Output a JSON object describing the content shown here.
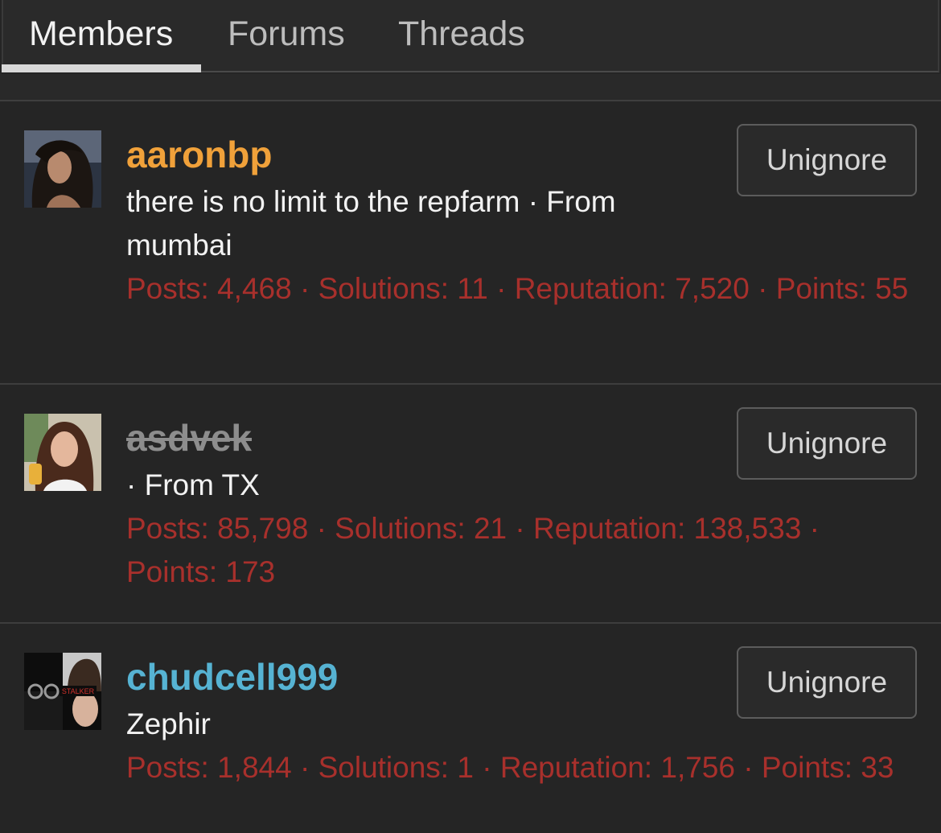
{
  "tabs": [
    {
      "label": "Members",
      "active": true
    },
    {
      "label": "Forums",
      "active": false
    },
    {
      "label": "Threads",
      "active": false
    }
  ],
  "members": [
    {
      "username": "aaronbp",
      "description": "there is no limit to the repfarm · From mumbai",
      "stats": {
        "posts_label": "Posts:",
        "posts": "4,468",
        "solutions_label": "Solutions:",
        "solutions": "11",
        "reputation_label": "Reputation:",
        "reputation": "7,520",
        "points_label": "Points:",
        "points": "55"
      },
      "button": "Unignore"
    },
    {
      "username": "asdvek",
      "description": "· From TX",
      "stats": {
        "posts_label": "Posts:",
        "posts": "85,798",
        "solutions_label": "Solutions:",
        "solutions": "21",
        "reputation_label": "Reputation:",
        "reputation": "138,533",
        "points_label": "Points:",
        "points": "173"
      },
      "button": "Unignore"
    },
    {
      "username": "chudcell999",
      "description": "Zephir",
      "stats": {
        "posts_label": "Posts:",
        "posts": "1,844",
        "solutions_label": "Solutions:",
        "solutions": "1",
        "reputation_label": "Reputation:",
        "reputation": "1,756",
        "points_label": "Points:",
        "points": "33"
      },
      "button": "Unignore",
      "avatar_text": "STALKER"
    }
  ],
  "colors": {
    "background": "#252525",
    "stats_red": "#a8302c",
    "username_orange": "#f0a13a",
    "username_blue": "#56b3d3",
    "username_gray": "#8d8d8d"
  }
}
